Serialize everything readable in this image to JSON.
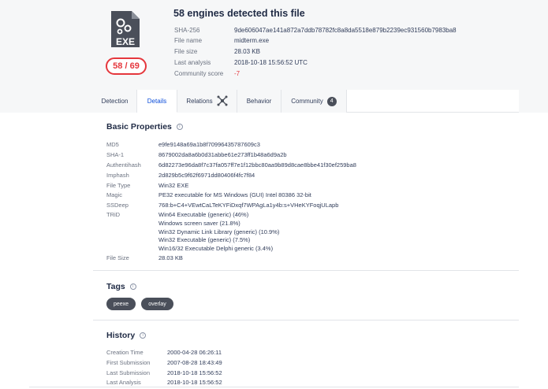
{
  "header": {
    "title": "58 engines detected this file",
    "score": "58 / 69",
    "file_type_icon": "EXE",
    "meta": [
      {
        "label": "SHA-256",
        "value": "9de606047ae141a872a7ddb78782fc8a8da5518e879b2239ec931560b7983ba8"
      },
      {
        "label": "File name",
        "value": "midterm.exe"
      },
      {
        "label": "File size",
        "value": "28.03 KB"
      },
      {
        "label": "Last analysis",
        "value": "2018-10-18 15:56:52 UTC"
      },
      {
        "label": "Community score",
        "value": "-7"
      }
    ]
  },
  "tabs": [
    {
      "label": "Detection"
    },
    {
      "label": "Details"
    },
    {
      "label": "Relations"
    },
    {
      "label": "Behavior"
    },
    {
      "label": "Community",
      "count": "4"
    }
  ],
  "basic_properties": {
    "title": "Basic Properties",
    "rows": [
      {
        "label": "MD5",
        "value": "e9fe9148a69a1b8f70996435787609c3"
      },
      {
        "label": "SHA-1",
        "value": "8679002da8a6b0d31abbe61e273ff1b48a6d9a2b"
      },
      {
        "label": "Authentihash",
        "value": "6d82273e96da8f7c37fa057ff7e1f12bbc80aa9b89d8cae8bbe41f30ef259ba8"
      },
      {
        "label": "Imphash",
        "value": "2d829b5c9f62f6971dd80406f4fc7f84"
      },
      {
        "label": "File Type",
        "value": "Win32 EXE"
      },
      {
        "label": "Magic",
        "value": "PE32 executable for MS Windows (GUI) Intel 80386 32-bit"
      },
      {
        "label": "SSDeep",
        "value": "768:b+C4+VEwtCaLTeKYFiDxqf7WPAgLa1y4b:s+VHeKYFoqjULapb"
      },
      {
        "label": "TRiD",
        "values": [
          "Win64 Executable (generic) (46%)",
          "Windows screen saver (21.8%)",
          "Win32 Dynamic Link Library (generic) (10.9%)",
          "Win32 Executable (generic) (7.5%)",
          "Win16/32 Executable Delphi generic (3.4%)"
        ]
      },
      {
        "label": "File Size",
        "value": "28.03 KB"
      }
    ]
  },
  "tags": {
    "title": "Tags",
    "items": [
      "peexe",
      "overlay"
    ]
  },
  "history": {
    "title": "History",
    "rows": [
      {
        "label": "Creation Time",
        "value": "2000-04-28 06:26:11"
      },
      {
        "label": "First Submission",
        "value": "2007-08-28 18:43:49"
      },
      {
        "label": "Last Submission",
        "value": "2018-10-18 15:56:52"
      },
      {
        "label": "Last Analysis",
        "value": "2018-10-18 15:56:52"
      }
    ]
  },
  "colors": {
    "accent": "#0b4dda",
    "danger": "#e5373d",
    "tag_bg": "#4a4f5a"
  }
}
